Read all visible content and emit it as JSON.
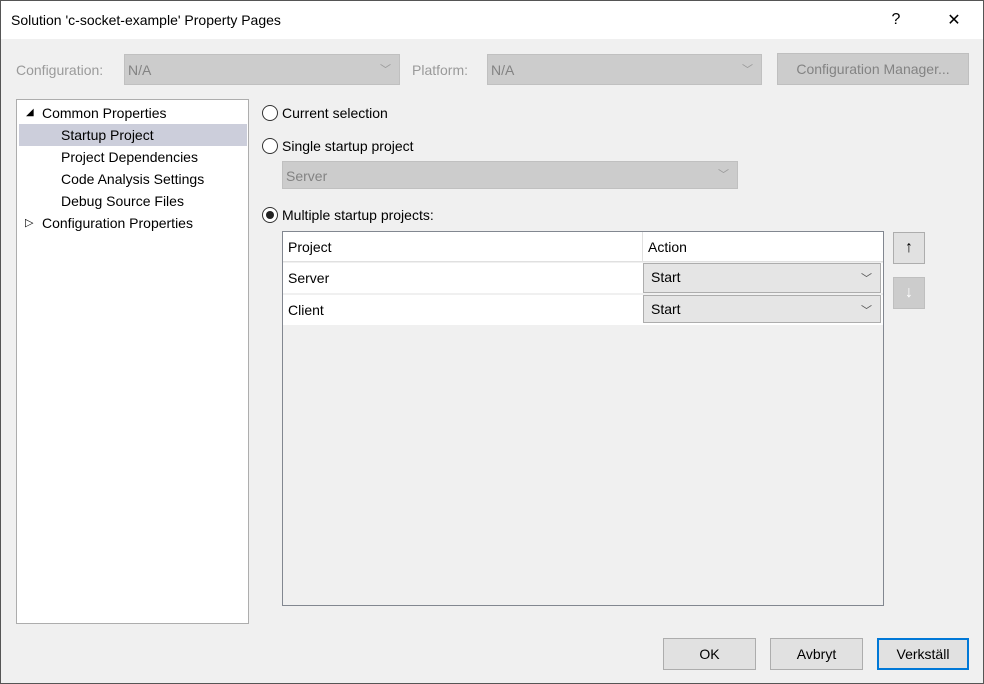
{
  "window": {
    "title": "Solution 'c-socket-example' Property Pages",
    "help": "?",
    "close": "✕"
  },
  "toolbar": {
    "configuration_label": "Configuration:",
    "configuration_value": "N/A",
    "platform_label": "Platform:",
    "platform_value": "N/A",
    "config_manager": "Configuration Manager..."
  },
  "tree": {
    "items": [
      {
        "label": "Common Properties",
        "expander": "◢"
      },
      {
        "label": "Startup Project"
      },
      {
        "label": "Project Dependencies"
      },
      {
        "label": "Code Analysis Settings"
      },
      {
        "label": "Debug Source Files"
      },
      {
        "label": "Configuration Properties",
        "expander": "▷"
      }
    ]
  },
  "startup": {
    "current": "Current selection",
    "single": "Single startup project",
    "single_value": "Server",
    "multiple": "Multiple startup projects:",
    "selected": "multiple",
    "grid": {
      "headers": [
        "Project",
        "Action"
      ],
      "rows": [
        {
          "project": "Server",
          "action": "Start"
        },
        {
          "project": "Client",
          "action": "Start"
        }
      ]
    },
    "up_icon": "↑",
    "down_icon": "↓"
  },
  "buttons": {
    "ok": "OK",
    "cancel": "Avbryt",
    "apply": "Verkställ"
  },
  "colors": {
    "selected_row": "#cccedb",
    "default_button_border": "#0078d7"
  }
}
